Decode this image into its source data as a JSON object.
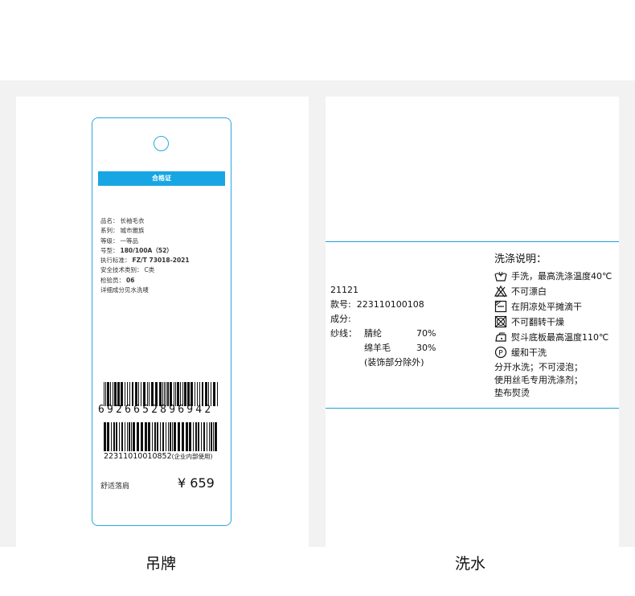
{
  "hang_tag": {
    "header": "合格证",
    "info": [
      {
        "label": "品名：",
        "value": "长袖毛衣"
      },
      {
        "label": "系列：",
        "value": "城市雅族"
      },
      {
        "label": "等级：",
        "value": "一等品"
      },
      {
        "label": "号型：",
        "value": "180/100A（52）"
      },
      {
        "label": "执行标准：",
        "value": "FZ/T 73018-2021"
      },
      {
        "label": "安全技术类别：",
        "value": "C类"
      },
      {
        "label": "检验员：",
        "value": "06"
      },
      {
        "label": "",
        "value": "详细成分见水洗唛"
      }
    ],
    "barcode1_digits": "6926652896942",
    "barcode2_number": "22311010010852",
    "barcode2_note": "(企业内部使用)",
    "fit": "舒适落肩",
    "price": "¥ 659"
  },
  "care_label": {
    "code": "21121",
    "style_label": "款号:",
    "style_no": "223110100108",
    "composition_label": "成分:",
    "yarn_label": "纱线：",
    "fibers": [
      {
        "name": "腈纶",
        "percent": "70%"
      },
      {
        "name": "绵羊毛",
        "percent": "30%"
      }
    ],
    "excluding": "(装饰部分除外)",
    "instructions_title": "洗涤说明：",
    "instructions": [
      {
        "icon": "hand-wash-icon",
        "text": "手洗，最高洗涤温度40℃"
      },
      {
        "icon": "no-bleach-icon",
        "text": "不可漂白"
      },
      {
        "icon": "flat-dry-shade-icon",
        "text": "在阴凉处平摊滴干"
      },
      {
        "icon": "no-tumble-dry-icon",
        "text": "不可翻转干燥"
      },
      {
        "icon": "iron-icon",
        "text": "熨斗底板最高温度110℃"
      },
      {
        "icon": "dry-clean-p-icon",
        "text": "缓和干洗"
      }
    ],
    "notes": [
      "分开水洗；不可浸泡；",
      "使用丝毛专用洗涤剂；",
      "垫布熨烫"
    ]
  },
  "captions": {
    "left": "吊牌",
    "right": "洗水"
  },
  "colors": {
    "accent": "#17a6e3",
    "background_band": "#f2f2f2"
  }
}
